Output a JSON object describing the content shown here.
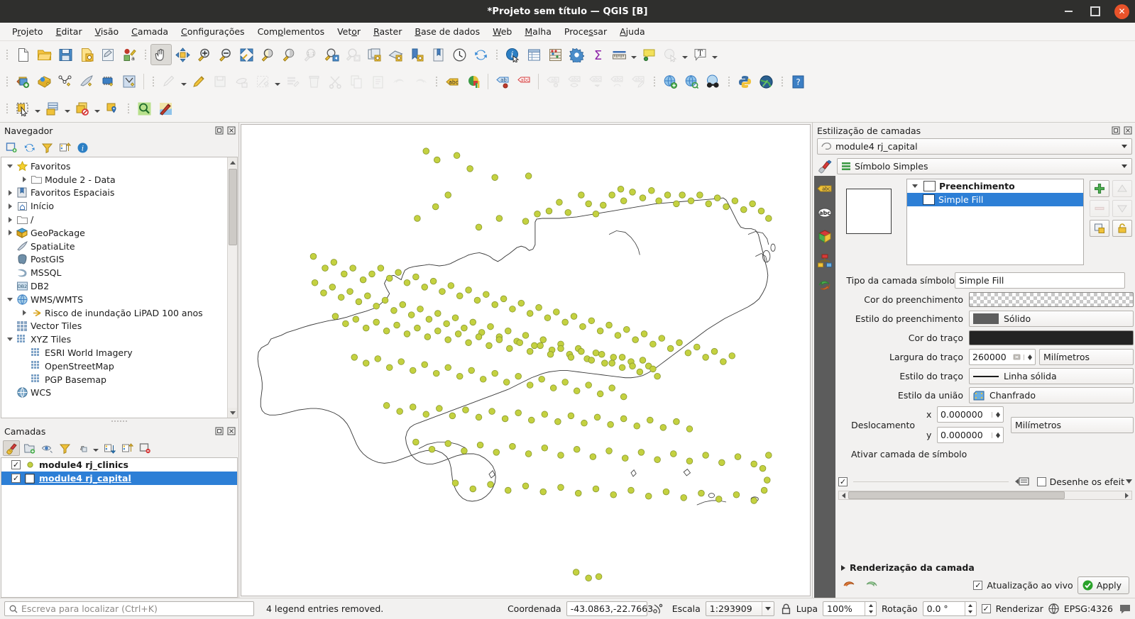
{
  "window": {
    "title": "*Projeto sem título — QGIS [B]",
    "minimize": "Minimizar",
    "maximize": "Maximizar",
    "close": "Fechar"
  },
  "menubar": [
    {
      "label": "Projeto",
      "name": "menu-projeto"
    },
    {
      "label": "Editar",
      "name": "menu-editar"
    },
    {
      "label": "Visão",
      "name": "menu-visao"
    },
    {
      "label": "Camada",
      "name": "menu-camada"
    },
    {
      "label": "Configurações",
      "name": "menu-configuracoes"
    },
    {
      "label": "Complementos",
      "name": "menu-complementos"
    },
    {
      "label": "Vetor",
      "name": "menu-vetor"
    },
    {
      "label": "Raster",
      "name": "menu-raster"
    },
    {
      "label": "Base de dados",
      "name": "menu-base-de-dados"
    },
    {
      "label": "Web",
      "name": "menu-web"
    },
    {
      "label": "Malha",
      "name": "menu-malha"
    },
    {
      "label": "Processar",
      "name": "menu-processar"
    },
    {
      "label": "Ajuda",
      "name": "menu-ajuda"
    }
  ],
  "browser_panel": {
    "title": "Navegador",
    "toolbar": [
      {
        "name": "add-layer-icon",
        "label": "Adicionar camada"
      },
      {
        "name": "refresh-icon",
        "label": "Atualizar"
      },
      {
        "name": "filter-icon",
        "label": "Filtrar navegador"
      },
      {
        "name": "collapse-all-icon",
        "label": "Colapsar tudo"
      },
      {
        "name": "properties-icon",
        "label": "Ativar/desativar propriedades"
      }
    ],
    "items": [
      {
        "label": "Favoritos",
        "icon": "star-icon",
        "indent": 0,
        "twist": "open"
      },
      {
        "label": "Module 2 - Data",
        "icon": "folder-icon",
        "indent": 1,
        "twist": "closed"
      },
      {
        "label": "Favoritos Espaciais",
        "icon": "bookmark-icon",
        "indent": 0,
        "twist": "closed"
      },
      {
        "label": "Início",
        "icon": "home-icon",
        "indent": 0,
        "twist": "closed"
      },
      {
        "label": "/",
        "icon": "folder-icon",
        "indent": 0,
        "twist": "closed"
      },
      {
        "label": "GeoPackage",
        "icon": "geopackage-icon",
        "indent": 0,
        "twist": "closed"
      },
      {
        "label": "SpatiaLite",
        "icon": "spatialite-icon",
        "indent": 0,
        "twist": "none"
      },
      {
        "label": "PostGIS",
        "icon": "postgis-icon",
        "indent": 0,
        "twist": "none"
      },
      {
        "label": "MSSQL",
        "icon": "mssql-icon",
        "indent": 0,
        "twist": "none"
      },
      {
        "label": "DB2",
        "icon": "db2-icon",
        "indent": 0,
        "twist": "none"
      },
      {
        "label": "WMS/WMTS",
        "icon": "wms-icon",
        "indent": 0,
        "twist": "open"
      },
      {
        "label": "Risco de inundação LiPAD 100 anos",
        "icon": "wms-connection-icon",
        "indent": 1,
        "twist": "closed"
      },
      {
        "label": "Vector Tiles",
        "icon": "vector-tiles-icon",
        "indent": 0,
        "twist": "none"
      },
      {
        "label": "XYZ Tiles",
        "icon": "xyz-tiles-icon",
        "indent": 0,
        "twist": "open"
      },
      {
        "label": "ESRI World Imagery",
        "icon": "xyz-tiles-icon",
        "indent": 1,
        "twist": "none"
      },
      {
        "label": "OpenStreetMap",
        "icon": "xyz-tiles-icon",
        "indent": 1,
        "twist": "none"
      },
      {
        "label": "PGP Basemap",
        "icon": "xyz-tiles-icon",
        "indent": 1,
        "twist": "none"
      },
      {
        "label": "WCS",
        "icon": "wcs-icon",
        "indent": 0,
        "twist": "none"
      }
    ]
  },
  "layers_panel": {
    "title": "Camadas",
    "toolbar": [
      {
        "name": "open-layer-styling-panel-icon",
        "label": "Abrir painel de estilo de camada",
        "selected": true
      },
      {
        "name": "add-group-icon",
        "label": "Adicionar grupo"
      },
      {
        "name": "manage-layer-visibility-icon",
        "label": "Gerenciar visibilidade"
      },
      {
        "name": "filter-legend-icon",
        "label": "Filtrar legenda"
      },
      {
        "name": "expression-filter-icon",
        "label": "Filtrar legenda por expressão"
      },
      {
        "name": "expand-all-icon",
        "label": "Expandir tudo"
      },
      {
        "name": "collapse-all-icon",
        "label": "Colapsar tudo"
      },
      {
        "name": "remove-layer-icon",
        "label": "Remover camada/grupo"
      }
    ],
    "layers": [
      {
        "name": "module4 rj_clinics",
        "checked": true,
        "selected": false,
        "symbol": "point-olive"
      },
      {
        "name": "module4 rj_capital",
        "checked": true,
        "selected": true,
        "symbol": "polygon-empty"
      }
    ]
  },
  "styling_panel": {
    "title": "Estilização de camadas",
    "layer_selector": {
      "value": "module4 rj_capital",
      "icon": "polygon-layer-icon"
    },
    "renderer_selector": {
      "value": "Símbolo Simples",
      "icon": "simple-symbol-icon"
    },
    "vertical_tabs": [
      {
        "name": "symbology-tab",
        "icon": "paintbrush-icon",
        "active": true
      },
      {
        "name": "labels-tab",
        "icon": "label-abc-icon"
      },
      {
        "name": "masks-tab",
        "icon": "abc-mask-icon"
      },
      {
        "name": "3d-view-tab",
        "icon": "cube-3d-icon"
      },
      {
        "name": "diagrams-tab",
        "icon": "diagram-icon"
      },
      {
        "name": "history-tab",
        "icon": "undo-history-icon"
      }
    ],
    "symbol_tree": [
      {
        "label": "Preenchimento",
        "bold": true,
        "twist": "open",
        "selected": false,
        "swatch": "white"
      },
      {
        "label": "Simple Fill",
        "bold": false,
        "twist": "none",
        "selected": true,
        "swatch": "white"
      }
    ],
    "symbol_buttons": [
      {
        "name": "add-symbol-layer-button",
        "icon": "plus-icon",
        "enabled": true
      },
      {
        "name": "move-up-button",
        "icon": "arrow-up-icon",
        "enabled": false
      },
      {
        "name": "remove-symbol-layer-button",
        "icon": "minus-icon",
        "enabled": false
      },
      {
        "name": "move-down-button",
        "icon": "arrow-down-icon",
        "enabled": false
      },
      {
        "name": "duplicate-symbol-layer-button",
        "icon": "duplicate-icon",
        "enabled": true
      },
      {
        "name": "lock-layer-button",
        "icon": "lock-icon",
        "enabled": true
      }
    ],
    "properties": {
      "symbol_layer_type_label": "Tipo da camada símbolo",
      "symbol_layer_type_value": "Simple Fill",
      "fill_color_label": "Cor do preenchimento",
      "fill_color_value": "transparent",
      "fill_style_label": "Estilo do preenchimento",
      "fill_style_value": "Sólido",
      "stroke_color_label": "Cor do traço",
      "stroke_color_value": "#232323",
      "stroke_width_label": "Largura do traço",
      "stroke_width_value": "260000",
      "stroke_width_unit": "Milímetros",
      "stroke_style_label": "Estilo do traço",
      "stroke_style_value": "Linha sólida",
      "join_style_label": "Estilo da união",
      "join_style_value": "Chanfrado",
      "offset_label": "Deslocamento",
      "offset_x_label": "x",
      "offset_x_value": "0.000000",
      "offset_y_label": "y",
      "offset_y_value": "0.000000",
      "offset_unit": "Milímetros",
      "enable_symbol_layer_label": "Ativar camada de símbolo",
      "draw_effects_label": "Desenhe os efeit"
    },
    "layer_rendering_label": "Renderização da camada",
    "live_update_label": "Atualização ao vivo",
    "live_update_checked": true,
    "apply_label": "Apply"
  },
  "statusbar": {
    "locator_placeholder": "Escreva para localizar (Ctrl+K)",
    "message": "4 legend entries removed.",
    "coordinate_label": "Coordenada",
    "coordinate_value": "-43.0863,-22.7663",
    "scale_label": "Escala",
    "scale_value": "1:293909",
    "magnifier_label": "Lupa",
    "magnifier_value": "100%",
    "rotation_label": "Rotação",
    "rotation_value": "0.0 °",
    "render_label": "Renderizar",
    "render_checked": true,
    "crs_label": "EPSG:4326"
  },
  "toolbars": {
    "row1": [
      {
        "name": "new-project-icon",
        "label": "Novo projeto"
      },
      {
        "name": "open-project-icon",
        "label": "Abrir projeto"
      },
      {
        "name": "save-project-icon",
        "label": "Salvar projeto"
      },
      {
        "name": "save-project-as-icon",
        "label": "Salvar projeto como"
      },
      {
        "name": "new-print-layout-icon",
        "label": "Novo layout de impressão"
      },
      {
        "name": "style-manager-icon",
        "label": "Gerenciador de estilos"
      },
      {
        "name": "pan-map-icon",
        "label": "Mover mapa",
        "active": true
      },
      {
        "name": "pan-to-selection-icon",
        "label": "Mover mapa para seleção"
      },
      {
        "name": "zoom-in-icon",
        "label": "Mais zoom"
      },
      {
        "name": "zoom-out-icon",
        "label": "Menos zoom"
      },
      {
        "name": "zoom-full-icon",
        "label": "Zoom total"
      },
      {
        "name": "zoom-selection-icon",
        "label": "Zoom para seleção"
      },
      {
        "name": "zoom-layer-icon",
        "label": "Zoom para camada"
      },
      {
        "name": "zoom-native-icon",
        "label": "Zoom na resolução nativa"
      },
      {
        "name": "zoom-last-icon",
        "label": "Último zoom"
      },
      {
        "name": "zoom-next-icon",
        "label": "Próximo zoom"
      },
      {
        "name": "new-map-view-icon",
        "label": "Nova visão do mapa"
      },
      {
        "name": "new-3d-map-view-icon",
        "label": "Nova visão 3D do mapa"
      },
      {
        "name": "new-print-layout2-icon",
        "label": "Novo layout"
      },
      {
        "name": "show-bookmarks-icon",
        "label": "Mostrar marcadores"
      },
      {
        "name": "temporal-controller-icon",
        "label": "Controlador temporal"
      },
      {
        "name": "refresh-map-icon",
        "label": "Atualizar"
      },
      {
        "name": "identify-features-icon",
        "label": "Identificar feições"
      },
      {
        "name": "open-attribute-table-icon",
        "label": "Abrir tabela de atributos"
      },
      {
        "name": "field-calculator-icon",
        "label": "Calculadora de campo"
      },
      {
        "name": "processing-toolbox-icon",
        "label": "Caixa de ferramentas"
      },
      {
        "name": "statistical-summary-icon",
        "label": "Sumário estatístico"
      },
      {
        "name": "measure-line-icon",
        "label": "Medir linha"
      },
      {
        "name": "map-tips-icon",
        "label": "Dicas do mapa"
      },
      {
        "name": "select-value-icon",
        "label": "Selecionar valor"
      },
      {
        "name": "text-annotation-icon",
        "label": "Anotação de texto"
      }
    ],
    "row2": [
      {
        "name": "open-data-source-manager-icon",
        "label": "Gerenciador de fonte de dados"
      },
      {
        "name": "add-vector-layer-icon",
        "label": "Adicionar camada vetorial"
      },
      {
        "name": "add-delimited-text-layer-icon",
        "label": "Adicionar camada de texto delimitado"
      },
      {
        "name": "add-spatialite-layer-icon",
        "label": "Adicionar camada SpatiaLite"
      },
      {
        "name": "add-mesh-layer-icon",
        "label": "Adicionar camada de malha"
      },
      {
        "name": "new-virtual-layer-icon",
        "label": "Nova camada virtual"
      },
      {
        "name": "current-edits-icon",
        "label": "Edições atuais"
      },
      {
        "name": "toggle-editing-icon",
        "label": "Alternar edição"
      },
      {
        "name": "save-layer-edits-icon",
        "label": "Salvar edições da camada"
      },
      {
        "name": "add-feature-icon",
        "label": "Adicionar feição"
      },
      {
        "name": "vertex-tool-icon",
        "label": "Ferramenta de vértice"
      },
      {
        "name": "modify-attributes-icon",
        "label": "Modificar atributos"
      },
      {
        "name": "delete-selected-icon",
        "label": "Apagar selecionados"
      },
      {
        "name": "cut-features-icon",
        "label": "Recortar feições"
      },
      {
        "name": "copy-features-icon",
        "label": "Copiar feições"
      },
      {
        "name": "paste-features-icon",
        "label": "Colar feições"
      },
      {
        "name": "undo-icon",
        "label": "Desfazer"
      },
      {
        "name": "redo-icon",
        "label": "Refazer"
      },
      {
        "name": "label-toolbar-icon",
        "label": "Rotular"
      },
      {
        "name": "diagram-toolbar-icon",
        "label": "Diagrama"
      },
      {
        "name": "pin-labels-icon",
        "label": "Fixar rótulos"
      },
      {
        "name": "highlight-labels-icon",
        "label": "Destacar rótulos"
      },
      {
        "name": "move-label-icon",
        "label": "Mover rótulo"
      },
      {
        "name": "show-hide-labels-icon",
        "label": "Mostrar/ocultar rótulos"
      },
      {
        "name": "rotate-label-icon",
        "label": "Rotacionar rótulo"
      },
      {
        "name": "change-label-icon",
        "label": "Alterar rótulo"
      },
      {
        "name": "edit-label-icon",
        "label": "Editar rótulo"
      },
      {
        "name": "add-wms-layer-icon",
        "label": "Adicionar camada WMS"
      },
      {
        "name": "metasearch-icon",
        "label": "MetaSearch"
      },
      {
        "name": "find-features-icon",
        "label": "Buscar feições"
      },
      {
        "name": "python-console-icon",
        "label": "Console Python"
      },
      {
        "name": "plugin-manager-icon",
        "label": "Gerenciador de complementos"
      },
      {
        "name": "help-contents-icon",
        "label": "Conteúdo de ajuda"
      }
    ],
    "row3": [
      {
        "name": "select-features-icon",
        "label": "Selecionar feições"
      },
      {
        "name": "select-by-form-icon",
        "label": "Selecionar por formulário"
      },
      {
        "name": "deselect-features-icon",
        "label": "Desfazer seleção"
      },
      {
        "name": "select-value-map-icon",
        "label": "Selecionar feição por valor"
      },
      {
        "name": "zoom-to-selection2-icon",
        "label": "Zoom para seleção"
      },
      {
        "name": "georeferencer-icon",
        "label": "Georreferenciador"
      }
    ]
  },
  "map": {
    "layer_name": "module4 rj_capital",
    "points_layer_name": "module4 rj_clinics",
    "point_color": "#c4d140",
    "point_stroke": "#87962a",
    "outline_color": "#3a3a3a"
  }
}
